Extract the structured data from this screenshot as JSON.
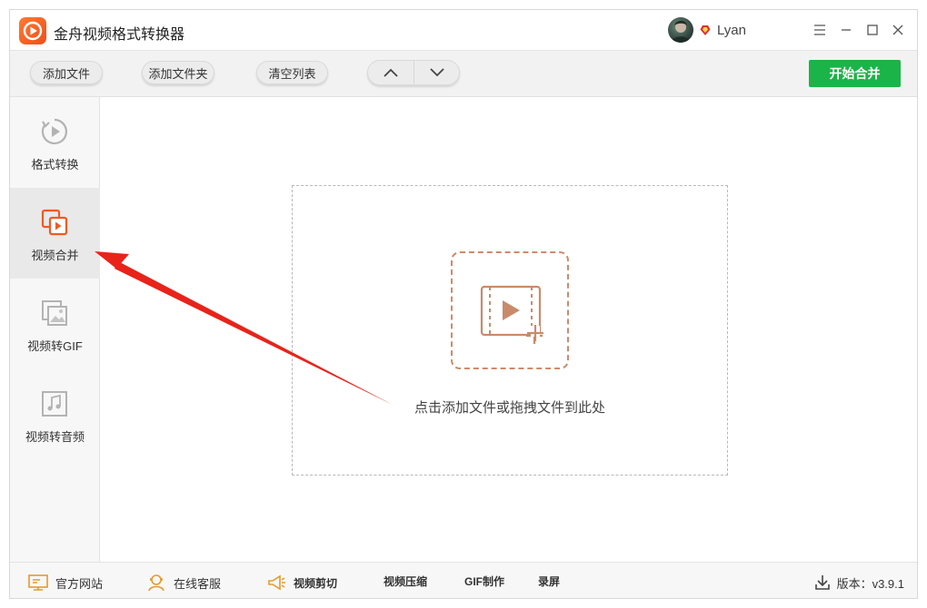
{
  "app": {
    "title": "金舟视频格式转换器",
    "user": "Lyan"
  },
  "window_controls": {
    "menu": "☰",
    "minimize": "—",
    "maximize": "☐",
    "close": "✕"
  },
  "toolbar": {
    "add_file": "添加文件",
    "add_folder": "添加文件夹",
    "clear_list": "清空列表",
    "move_up": "up",
    "move_down": "down",
    "start": "开始合并"
  },
  "sidebar": {
    "items": [
      {
        "label": "格式转换",
        "icon": "format-convert-icon",
        "active": false
      },
      {
        "label": "视频合并",
        "icon": "video-merge-icon",
        "active": true
      },
      {
        "label": "视频转GIF",
        "icon": "gif-image-icon",
        "active": false
      },
      {
        "label": "视频转音频",
        "icon": "music-note-icon",
        "active": false
      }
    ]
  },
  "main": {
    "drop_hint": "点击添加文件或拖拽文件到此处"
  },
  "footer": {
    "official_site": "官方网站",
    "online_service": "在线客服",
    "video_cut": "视频剪切",
    "video_compress": "视频压缩",
    "gif_make": "GIF制作",
    "record": "录屏",
    "version": "版本：v3.9.1"
  },
  "colors": {
    "accent": "#f05a24",
    "start_button": "#1bb449",
    "annotation_arrow": "#e8231a"
  }
}
